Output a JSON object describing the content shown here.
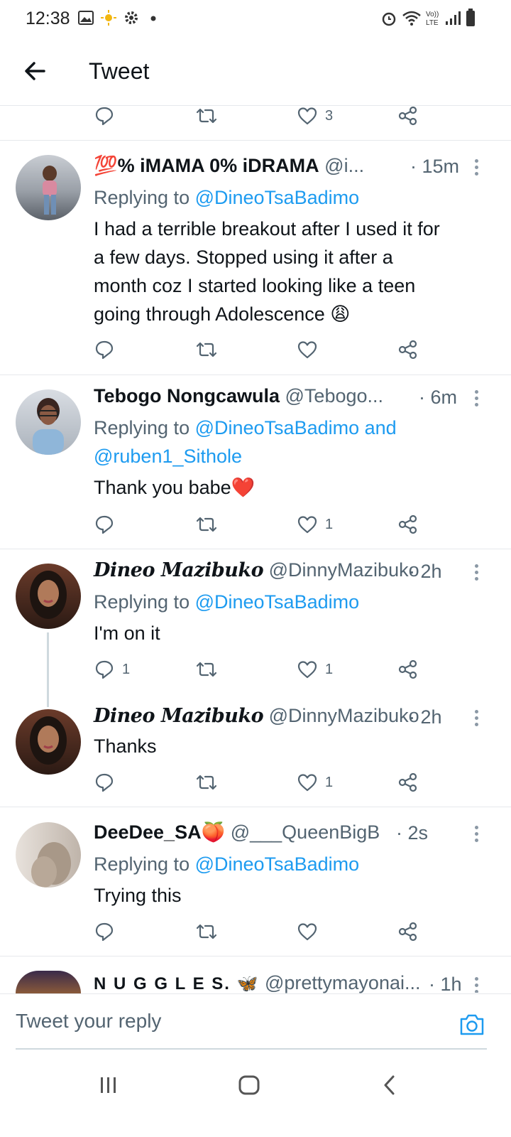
{
  "status_bar": {
    "time": "12:38"
  },
  "header": {
    "title": "Tweet",
    "back_icon": "arrow-left-icon"
  },
  "colors": {
    "link": "#1d9bf0",
    "muted": "#536471",
    "heart": "#e0245e"
  },
  "top_actions": {
    "like_count": "3"
  },
  "tweets": [
    {
      "emoji_prefix": "💯",
      "name": "% iMAMA 0% iDRAMA",
      "handle": "@i...",
      "time": "· 15m",
      "replying_prefix": "Replying to ",
      "replying_to": "@DineoTsaBadimo",
      "text_lines": [
        "I had a terrible breakout after I used it for",
        "a few days. Stopped using it after a",
        "month coz I started looking like a teen",
        "going through Adolescence 😩"
      ],
      "reply_count": "",
      "like_count": ""
    },
    {
      "name": "Tebogo Nongcawula",
      "handle": "@Tebogo...",
      "time": "· 6m",
      "replying_prefix": "Replying to ",
      "replying_to": "@DineoTsaBadimo and",
      "replying_to_2": "@ruben1_Sithole",
      "text": "Thank you babe❤️",
      "reply_count": "",
      "like_count": "1"
    },
    {
      "name": "Dineo Mazibuko",
      "handle": "@DinnyMazibuko",
      "time": "· 2h",
      "replying_prefix": "Replying to ",
      "replying_to": "@DineoTsaBadimo",
      "text": "I'm on it",
      "reply_count": "1",
      "like_count": "1"
    },
    {
      "name": "Dineo Mazibuko",
      "handle": "@DinnyMazibuko",
      "time": "· 2h",
      "text": "Thanks",
      "reply_count": "",
      "like_count": "1"
    },
    {
      "name": "DeeDee_SA🍑",
      "handle": "@___QueenBigB",
      "time": "· 2s",
      "replying_prefix": "Replying to ",
      "replying_to": "@DineoTsaBadimo",
      "text": "Trying this",
      "reply_count": "",
      "like_count": ""
    },
    {
      "name": "N U G G L E S. 🦋",
      "handle": "@prettymayonai...",
      "time": "· 1h"
    }
  ],
  "reply_bar": {
    "placeholder": "Tweet your reply",
    "camera_icon": "camera-icon"
  },
  "nav": {
    "recents_icon": "recents-icon",
    "home_icon": "home-icon",
    "back_icon": "back-chevron-icon"
  }
}
